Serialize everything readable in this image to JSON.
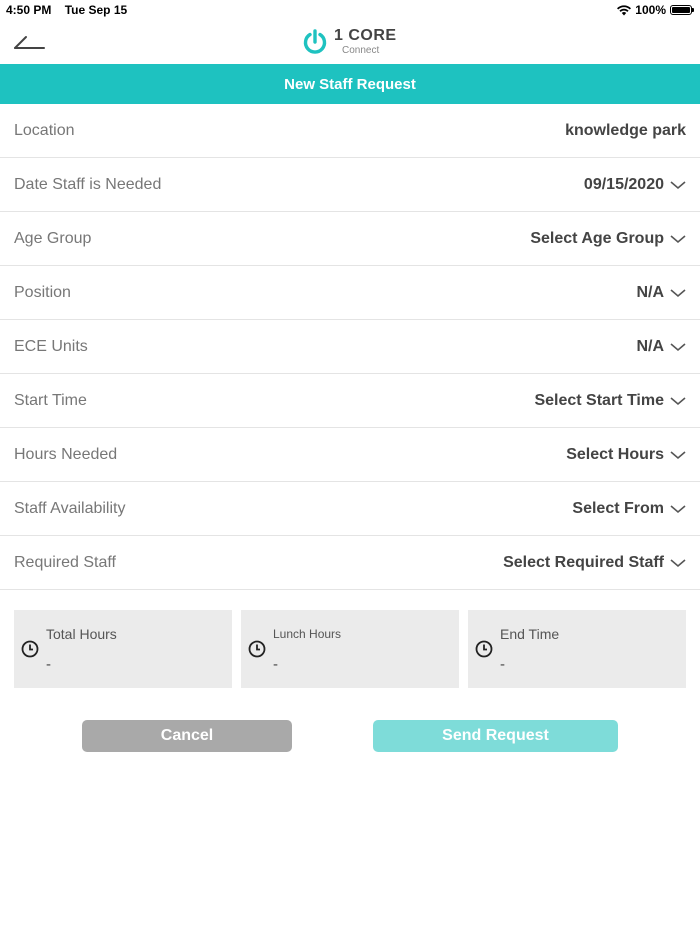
{
  "status_bar": {
    "time": "4:50 PM",
    "date": "Tue Sep 15",
    "battery": "100%"
  },
  "nav": {
    "brand": "1 CORE",
    "brand_sub": "Connect"
  },
  "page_title": "New Staff Request",
  "form_rows": [
    {
      "label": "Location",
      "value": "knowledge park",
      "chevron": false
    },
    {
      "label": "Date Staff is Needed",
      "value": "09/15/2020",
      "chevron": true
    },
    {
      "label": "Age Group",
      "value": "Select Age Group",
      "chevron": true
    },
    {
      "label": "Position",
      "value": "N/A",
      "chevron": true
    },
    {
      "label": "ECE Units",
      "value": "N/A",
      "chevron": true
    },
    {
      "label": "Start Time",
      "value": "Select Start Time",
      "chevron": true
    },
    {
      "label": "Hours Needed",
      "value": "Select Hours",
      "chevron": true
    },
    {
      "label": "Staff Availability",
      "value": "Select From",
      "chevron": true
    },
    {
      "label": "Required Staff",
      "value": "Select Required Staff",
      "chevron": true
    }
  ],
  "summary": {
    "total_hours": {
      "label": "Total Hours",
      "value": "-"
    },
    "lunch_hours": {
      "label": "Lunch Hours",
      "value": "-"
    },
    "end_time": {
      "label": "End Time",
      "value": "-"
    }
  },
  "buttons": {
    "cancel": "Cancel",
    "send": "Send Request"
  },
  "colors": {
    "accent": "#1ec2c0",
    "send_button": "#7edcd9",
    "cancel_button": "#a9a9a9",
    "card_background": "#ebebeb"
  },
  "icons": {
    "back": "back-arrow-icon",
    "logo": "power-icon",
    "wifi": "wifi-icon",
    "battery": "battery-icon",
    "chevron": "chevron-down-icon",
    "clock": "clock-icon"
  }
}
